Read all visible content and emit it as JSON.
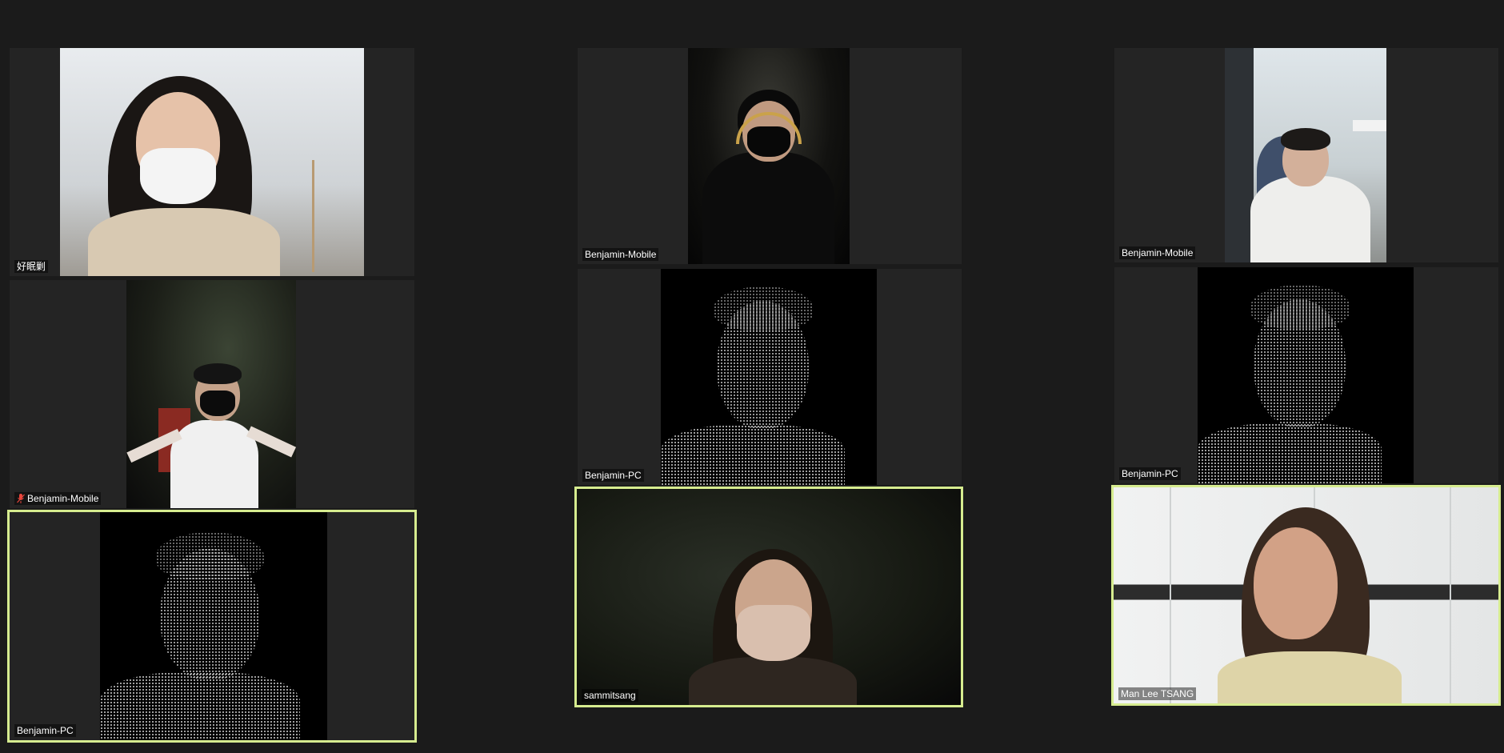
{
  "participants": [
    {
      "name": "好眠剿",
      "muted": false,
      "speaking": false
    },
    {
      "name": "Benjamin-Mobile",
      "muted": false,
      "speaking": false
    },
    {
      "name": "Benjamin-Mobile",
      "muted": false,
      "speaking": false
    },
    {
      "name": "Benjamin-Mobile",
      "muted": true,
      "speaking": false
    },
    {
      "name": "Benjamin-PC",
      "muted": false,
      "speaking": false
    },
    {
      "name": "Benjamin-PC",
      "muted": false,
      "speaking": false
    },
    {
      "name": "Benjamin-PC",
      "muted": false,
      "speaking": true
    },
    {
      "name": "sammitsang",
      "muted": false,
      "speaking": true
    },
    {
      "name": "Man Lee TSANG",
      "muted": false,
      "speaking": true
    }
  ],
  "icons": {
    "muted": "muted-mic-icon"
  },
  "colors": {
    "background": "#1b1b1b",
    "tile": "#242424",
    "active_speaker_border": "#d6ec8f",
    "muted_icon": "#e8453c"
  }
}
